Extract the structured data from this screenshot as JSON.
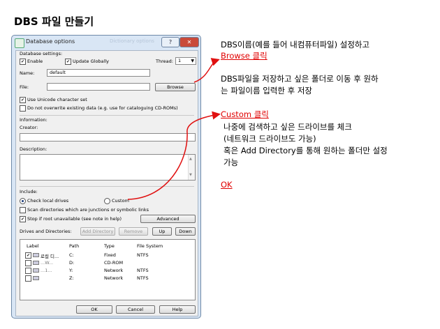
{
  "page": {
    "heading": "DBS 파일 만들기"
  },
  "dialog": {
    "title": "Database options",
    "ghost_title": "Dictionary options",
    "help_glyph": "?",
    "close_glyph": "✕",
    "settings_label": "Database settings:",
    "enable_label": "Enable",
    "update_globally_label": "Update Globally",
    "thread_label": "Thread:",
    "thread_value": "1",
    "name_label": "Name:",
    "name_value": "default",
    "file_label": "File:",
    "file_value": "",
    "browse_button": "Browse",
    "unicode_label": "Use Unicode character set",
    "no_overwrite_label": "Do not overwrite existing data (e.g. use for cataloguing CD-ROMs)",
    "information_label": "Information:",
    "creator_label": "Creator:",
    "description_label": "Description:",
    "include_label": "Include:",
    "check_local_label": "Check local drives",
    "custom_label": "Custom",
    "scan_dirs_label": "Scan directories which are junctions or symbolic links",
    "stop_root_label": "Stop if root unavailable (see note in help)",
    "advanced_button": "Advanced",
    "drives_label": "Drives and Directories:",
    "add_directory_button": "Add Directory",
    "remove_button": "Remove",
    "up_button": "Up",
    "down_button": "Down",
    "columns": [
      "Label",
      "Path",
      "Type",
      "File System"
    ],
    "drives": [
      {
        "label": "로컬 디...",
        "path": "C:",
        "type": "Fixed",
        "fs": "NTFS",
        "checked": true
      },
      {
        "label": "...W...",
        "path": "D:",
        "type": "CD-ROM",
        "fs": "",
        "checked": false
      },
      {
        "label": "...1...",
        "path": "Y:",
        "type": "Network",
        "fs": "NTFS",
        "checked": false
      },
      {
        "label": "",
        "path": "Z:",
        "type": "Network",
        "fs": "NTFS",
        "checked": false
      }
    ],
    "ok_button": "OK",
    "cancel_button": "Cancel",
    "help_button": "Help"
  },
  "annotations": {
    "a1_line1": "DBS이름(예를 들어 내컴퓨터파일) 설정하고",
    "a1_link": "Browse 클릭",
    "a2_line1": "DBS파일을 저장하고 싶은 폴더로 이동 후 원하",
    "a2_line2": "는 파일이름 입력한 후 저장",
    "a3_link": "Custom 클릭",
    "a3_line1": "나중에 검색하고 싶은 드라이브를 체크",
    "a3_line2": "(네트워크 드라이브도 가능)",
    "a3_line3": "혹은 Add Directory를 통해 원하는 폴더만 설정",
    "a3_line4": "가능",
    "ok_link": "OK"
  },
  "colors": {
    "annotation_red": "#e00000",
    "arrow_red": "#e01010"
  }
}
